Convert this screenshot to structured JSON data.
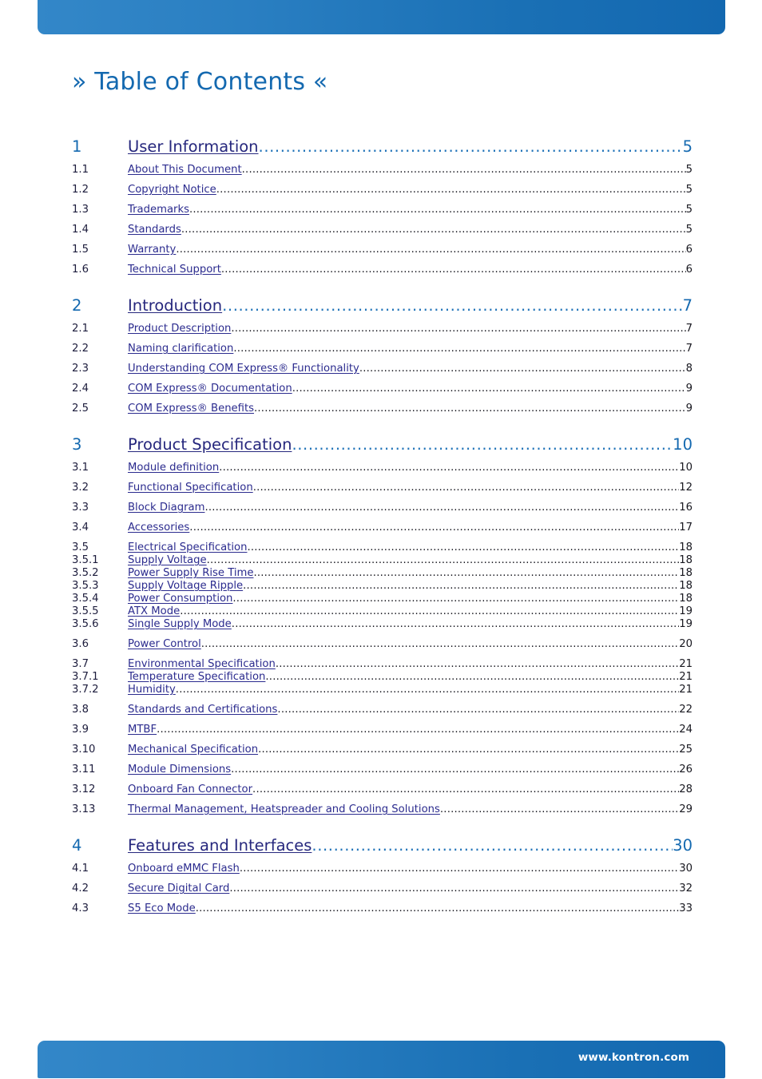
{
  "header": {
    "bar_color_left": "#3387c8",
    "bar_color_right": "#1368b0"
  },
  "page_title": "» Table of Contents «",
  "footer": {
    "url": "www.kontron.com"
  },
  "colors": {
    "level1_accent": "#1469b0",
    "level1_label": "#26277d",
    "sub_label": "#2b2b8e",
    "sub_text": "#17171f"
  },
  "toc": {
    "entries": [
      {
        "level": 1,
        "number": "1",
        "label": "User Information",
        "page": "5"
      },
      {
        "level": 2,
        "number": "1.1",
        "label": "About This Document",
        "page": "5"
      },
      {
        "level": 2,
        "number": "1.2",
        "label": "Copyright Notice",
        "page": "5"
      },
      {
        "level": 2,
        "number": "1.3",
        "label": "Trademarks",
        "page": "5"
      },
      {
        "level": 2,
        "number": "1.4",
        "label": "Standards",
        "page": "5"
      },
      {
        "level": 2,
        "number": "1.5",
        "label": "Warranty",
        "page": "6"
      },
      {
        "level": 2,
        "number": "1.6",
        "label": "Technical Support",
        "page": "6"
      },
      {
        "level": 1,
        "number": "2",
        "label": "Introduction",
        "page": "7"
      },
      {
        "level": 2,
        "number": "2.1",
        "label": "Product Description",
        "page": "7"
      },
      {
        "level": 2,
        "number": "2.2",
        "label": "Naming clarification",
        "page": "7"
      },
      {
        "level": 2,
        "number": "2.3",
        "label": "Understanding COM Express® Functionality",
        "page": "8"
      },
      {
        "level": 2,
        "number": "2.4",
        "label": "COM Express® Documentation",
        "page": "9"
      },
      {
        "level": 2,
        "number": "2.5",
        "label": "COM Express® Benefits",
        "page": "9"
      },
      {
        "level": 1,
        "number": "3",
        "label": "Product Specification",
        "page": "10"
      },
      {
        "level": 2,
        "number": "3.1",
        "label": "Module definition",
        "page": "10"
      },
      {
        "level": 2,
        "number": "3.2",
        "label": "Functional Specification",
        "page": "12"
      },
      {
        "level": 2,
        "number": "3.3",
        "label": "Block Diagram",
        "page": "16"
      },
      {
        "level": 2,
        "number": "3.4",
        "label": "Accessories",
        "page": "17"
      },
      {
        "level": 2,
        "number": "3.5",
        "label": " Electrical Specification",
        "page": "18"
      },
      {
        "level": 3,
        "number": "3.5.1",
        "label": "Supply Voltage",
        "page": "18"
      },
      {
        "level": 3,
        "number": "3.5.2",
        "label": "Power Supply Rise Time",
        "page": "18"
      },
      {
        "level": 3,
        "number": "3.5.3",
        "label": "Supply Voltage Ripple",
        "page": "18"
      },
      {
        "level": 3,
        "number": "3.5.4",
        "label": "Power Consumption",
        "page": "18"
      },
      {
        "level": 3,
        "number": "3.5.5",
        "label": "ATX Mode",
        "page": "19"
      },
      {
        "level": 3,
        "number": "3.5.6",
        "label": "Single Supply Mode",
        "page": "19"
      },
      {
        "level": 2,
        "number": "3.6",
        "label": "Power Control",
        "page": "20"
      },
      {
        "level": 2,
        "number": "3.7",
        "label": "Environmental Specification",
        "page": "21"
      },
      {
        "level": 3,
        "number": "3.7.1",
        "label": "Temperature Specification",
        "page": "21"
      },
      {
        "level": 3,
        "number": "3.7.2",
        "label": "Humidity",
        "page": "21"
      },
      {
        "level": 2,
        "number": "3.8",
        "label": "Standards and Certifications",
        "page": "22"
      },
      {
        "level": 2,
        "number": "3.9",
        "label": "MTBF",
        "page": "24"
      },
      {
        "level": 2,
        "number": "3.10",
        "label": "Mechanical Specification",
        "page": "25"
      },
      {
        "level": 2,
        "number": "3.11",
        "label": "Module Dimensions",
        "page": "26"
      },
      {
        "level": 2,
        "number": "3.12",
        "label": "Onboard Fan Connector",
        "page": "28"
      },
      {
        "level": 2,
        "number": "3.13",
        "label": "Thermal Management, Heatspreader and Cooling Solutions",
        "page": "29"
      },
      {
        "level": 1,
        "number": "4",
        "label": "Features and Interfaces",
        "page": "30"
      },
      {
        "level": 2,
        "number": "4.1",
        "label": "Onboard eMMC Flash",
        "page": "30"
      },
      {
        "level": 2,
        "number": "4.2",
        "label": "Secure Digital Card",
        "page": "32"
      },
      {
        "level": 2,
        "number": "4.3",
        "label": "S5 Eco Mode",
        "page": "33"
      }
    ]
  }
}
